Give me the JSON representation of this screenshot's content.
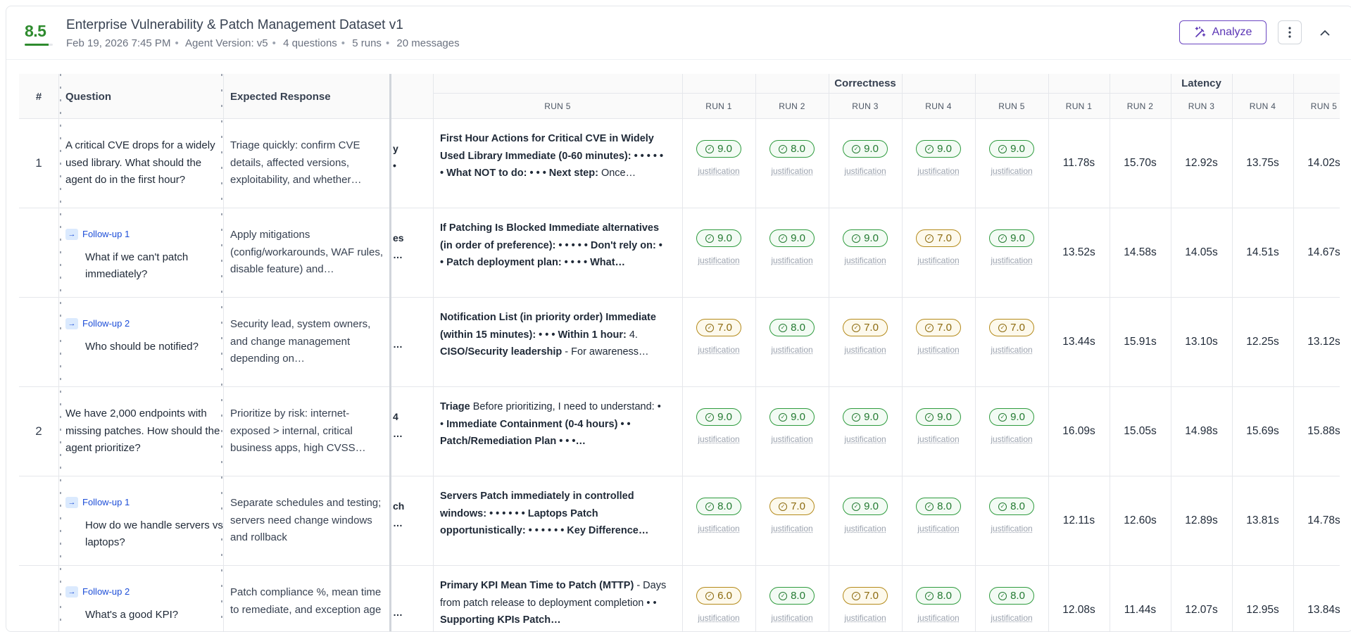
{
  "header": {
    "score": "8.5",
    "title": "Enterprise Vulnerability & Patch Management Dataset v1",
    "meta": [
      "Feb 19, 2026 7:45 PM",
      "Agent Version: v5",
      "4 questions",
      "5 runs",
      "20 messages"
    ],
    "analyze_label": "Analyze",
    "colors": {
      "score": "#2e8b2e",
      "accent": "#6b46c1"
    }
  },
  "table": {
    "col_num": "#",
    "col_question": "Question",
    "col_expected": "Expected Response",
    "col_run5": "RUN 5",
    "group_correctness": "Correctness",
    "group_latency": "Latency",
    "run_labels": [
      "RUN 1",
      "RUN 2",
      "RUN 3",
      "RUN 4",
      "RUN 5"
    ],
    "justification_label": "justification",
    "rows": [
      {
        "num": "1",
        "followup": "",
        "question": "A critical CVE drops for a widely used library. What should the agent do in the first hour?",
        "expected": "Triage quickly: confirm CVE details, affected versions, exploitability, and whether…",
        "frag": "y\n•",
        "run5": [
          {
            "b": "First Hour Actions for Critical CVE in Widely Used Library Immediate (0-60 minutes): • • • • • • What NOT to do: • • • Next step: "
          },
          {
            "t": "Once…"
          }
        ],
        "scores": [
          {
            "v": "9.0",
            "c": "g"
          },
          {
            "v": "8.0",
            "c": "g"
          },
          {
            "v": "9.0",
            "c": "g"
          },
          {
            "v": "9.0",
            "c": "g"
          },
          {
            "v": "9.0",
            "c": "g"
          }
        ],
        "latency": [
          "11.78s",
          "15.70s",
          "12.92s",
          "13.75s",
          "14.02s"
        ]
      },
      {
        "num": "",
        "followup": "Follow-up 1",
        "question": "What if we can't patch immediately?",
        "expected": "Apply mitigations (config/workarounds, WAF rules, disable feature) and…",
        "frag": "es\n…",
        "run5": [
          {
            "b": "If Patching Is Blocked Immediate alternatives (in order of preference): • • • • • Don't rely on: • • Patch deployment plan: • • • • What…"
          }
        ],
        "scores": [
          {
            "v": "9.0",
            "c": "g"
          },
          {
            "v": "9.0",
            "c": "g"
          },
          {
            "v": "9.0",
            "c": "g"
          },
          {
            "v": "7.0",
            "c": "y"
          },
          {
            "v": "9.0",
            "c": "g"
          }
        ],
        "latency": [
          "13.52s",
          "14.58s",
          "14.05s",
          "14.51s",
          "14.67s"
        ]
      },
      {
        "num": "",
        "followup": "Follow-up 2",
        "question": "Who should be notified?",
        "expected": "Security lead, system owners, and change management depending on…",
        "frag": "\n…",
        "run5": [
          {
            "b": "Notification List (in priority order) Immediate (within 15 minutes): • • • Within 1 hour: "
          },
          {
            "t": "4. "
          },
          {
            "b": "CISO/Security leadership"
          },
          {
            "t": " - For awareness…"
          }
        ],
        "scores": [
          {
            "v": "7.0",
            "c": "y"
          },
          {
            "v": "8.0",
            "c": "g"
          },
          {
            "v": "7.0",
            "c": "y"
          },
          {
            "v": "7.0",
            "c": "y"
          },
          {
            "v": "7.0",
            "c": "y"
          }
        ],
        "latency": [
          "13.44s",
          "15.91s",
          "13.10s",
          "12.25s",
          "13.12s"
        ]
      },
      {
        "num": "2",
        "followup": "",
        "question": "We have 2,000 endpoints with missing patches. How should the agent prioritize?",
        "expected": "Prioritize by risk: internet-exposed > internal, critical business apps, high CVSS…",
        "frag": "4\n…",
        "run5": [
          {
            "b": "Triage"
          },
          {
            "t": " Before prioritizing, I need to understand: • • "
          },
          {
            "b": "Immediate Containment (0-4 hours) • • Patch/Remediation Plan • • •…"
          }
        ],
        "scores": [
          {
            "v": "9.0",
            "c": "g"
          },
          {
            "v": "9.0",
            "c": "g"
          },
          {
            "v": "9.0",
            "c": "g"
          },
          {
            "v": "9.0",
            "c": "g"
          },
          {
            "v": "9.0",
            "c": "g"
          }
        ],
        "latency": [
          "16.09s",
          "15.05s",
          "14.98s",
          "15.69s",
          "15.88s"
        ]
      },
      {
        "num": "",
        "followup": "Follow-up 1",
        "question": "How do we handle servers vs laptops?",
        "expected": "Separate schedules and testing; servers need change windows and rollback",
        "frag": "ch\n…",
        "run5": [
          {
            "b": "Servers Patch immediately in controlled windows: • • • • • • Laptops Patch opportunistically: • • • • • • Key Difference…"
          }
        ],
        "scores": [
          {
            "v": "8.0",
            "c": "g"
          },
          {
            "v": "7.0",
            "c": "y"
          },
          {
            "v": "9.0",
            "c": "g"
          },
          {
            "v": "8.0",
            "c": "g"
          },
          {
            "v": "8.0",
            "c": "g"
          }
        ],
        "latency": [
          "12.11s",
          "12.60s",
          "12.89s",
          "13.81s",
          "14.78s"
        ]
      },
      {
        "num": "",
        "followup": "Follow-up 2",
        "question": "What's a good KPI?",
        "expected": "Patch compliance %, mean time to remediate, and exception age",
        "frag": "\n…",
        "run5": [
          {
            "b": "Primary KPI Mean Time to Patch (MTTP)"
          },
          {
            "t": " - Days from patch release to deployment completion • • "
          },
          {
            "b": "Supporting KPIs Patch…"
          }
        ],
        "scores": [
          {
            "v": "6.0",
            "c": "y"
          },
          {
            "v": "8.0",
            "c": "g"
          },
          {
            "v": "7.0",
            "c": "y"
          },
          {
            "v": "8.0",
            "c": "g"
          },
          {
            "v": "8.0",
            "c": "g"
          }
        ],
        "latency": [
          "12.08s",
          "11.44s",
          "12.07s",
          "12.95s",
          "13.84s"
        ]
      }
    ]
  }
}
